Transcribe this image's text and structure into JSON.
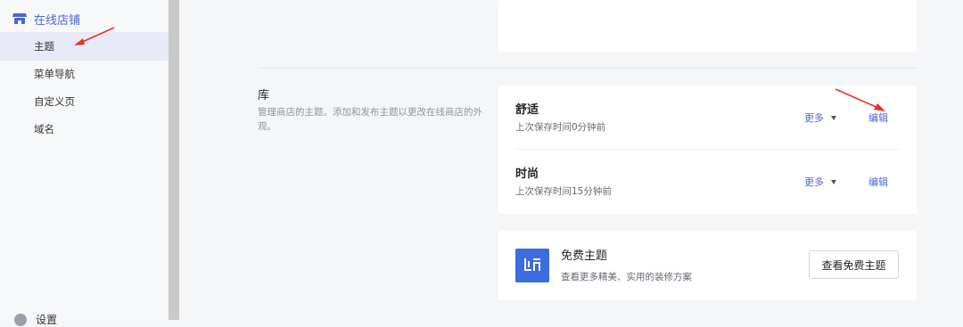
{
  "sidebar": {
    "store_label": "在线店铺",
    "items": [
      {
        "label": "主题",
        "active": true
      },
      {
        "label": "菜单导航",
        "active": false
      },
      {
        "label": "自定义页",
        "active": false
      },
      {
        "label": "域名",
        "active": false
      }
    ],
    "bottom_label": "设置"
  },
  "library": {
    "title": "库",
    "description": "管理商店的主题。添加和发布主题以更改在线商店的外观。",
    "themes": [
      {
        "name": "舒适",
        "saved": "上次保存时间0分钟前",
        "more_label": "更多",
        "edit_label": "编辑"
      },
      {
        "name": "时尚",
        "saved": "上次保存时间15分钟前",
        "more_label": "更多",
        "edit_label": "编辑"
      }
    ]
  },
  "free_themes": {
    "title": "免费主题",
    "description": "查看更多精美、实用的装修方案",
    "button_label": "查看免费主题",
    "icon": "layout-icon"
  },
  "colors": {
    "accent": "#4b66d8",
    "annotation_arrow": "#e8312a",
    "active_nav_bg": "#e8ebf7"
  }
}
